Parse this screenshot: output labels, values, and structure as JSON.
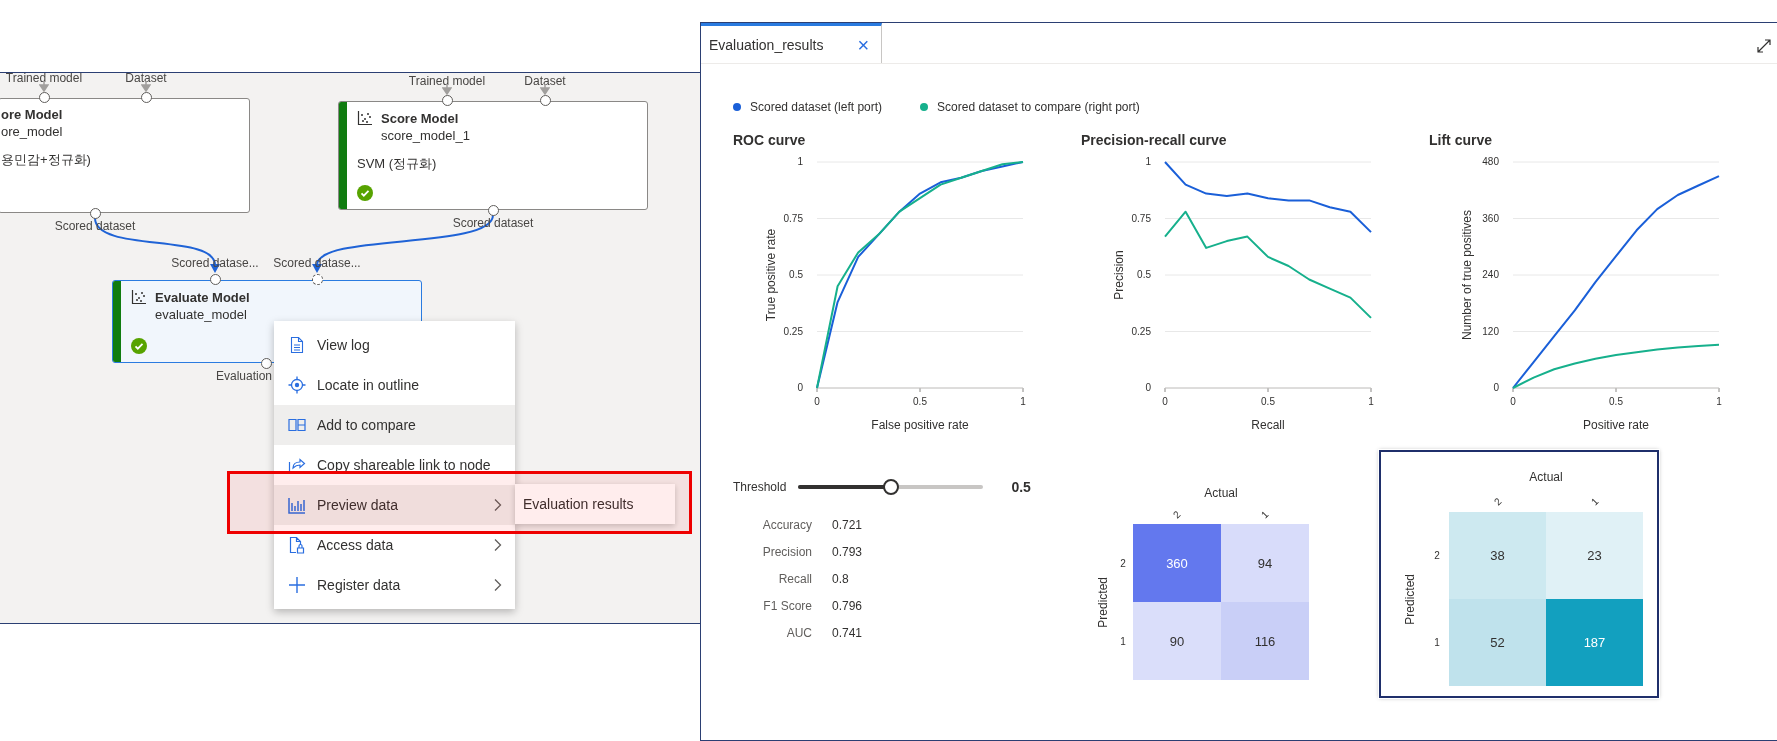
{
  "canvas": {
    "nodes": [
      {
        "title": "ore Model",
        "name": "ore_model",
        "description": "용민감+정규화)",
        "selected": false,
        "in_ports": [
          {
            "label": "Trained model",
            "connected": true
          },
          {
            "label": "Dataset",
            "connected": true
          }
        ],
        "out_ports": [
          {
            "label": "Scored dataset"
          }
        ]
      },
      {
        "title": "Score Model",
        "name": "score_model_1",
        "description": "SVM (정규화)",
        "completed": true,
        "selected": false,
        "in_ports": [
          {
            "label": "Trained model",
            "connected": true
          },
          {
            "label": "Dataset",
            "connected": true
          }
        ],
        "out_ports": [
          {
            "label": "Scored dataset"
          }
        ]
      },
      {
        "title": "Evaluate Model",
        "name": "evaluate_model",
        "completed": true,
        "selected": true,
        "in_ports": [
          {
            "label": "Scored datase...",
            "optional": false
          },
          {
            "label": "Scored datase...",
            "optional": true
          }
        ],
        "out_ports": [
          {
            "label": "Evaluation"
          }
        ]
      }
    ],
    "context_menu": {
      "items": [
        {
          "label": "View log",
          "highlighted": false,
          "submenu": false
        },
        {
          "label": "Locate in outline",
          "highlighted": false,
          "submenu": false
        },
        {
          "label": "Add to compare",
          "highlighted": true,
          "submenu": false
        },
        {
          "label": "Copy shareable link to node",
          "highlighted": false,
          "submenu": false
        },
        {
          "label": "Preview data",
          "highlighted": true,
          "submenu": true
        },
        {
          "label": "Access data",
          "highlighted": false,
          "submenu": true
        },
        {
          "label": "Register data",
          "highlighted": false,
          "submenu": true
        }
      ],
      "submenu": {
        "items": [
          "Evaluation results"
        ]
      },
      "highlight_box": true
    }
  },
  "panel": {
    "tabs": [
      {
        "label": "Evaluation_results",
        "selected": true,
        "close": "×"
      }
    ],
    "legend": [
      {
        "label": "Scored dataset (left port)",
        "color": "#1a5fd8"
      },
      {
        "label": "Scored dataset to compare (right port)",
        "color": "#16b08c"
      }
    ],
    "charts": [
      {
        "chart_data": {
          "type": "line",
          "title": "ROC curve",
          "xlabel": "False positive rate",
          "ylabel": "True positive rate",
          "x": [
            0,
            0.1,
            0.2,
            0.3,
            0.4,
            0.5,
            0.6,
            0.7,
            0.8,
            0.9,
            1
          ],
          "xlim": [
            0,
            1
          ],
          "ylim": [
            0,
            1
          ],
          "xticks": [
            0,
            0.5,
            1
          ],
          "yticks": [
            0,
            0.25,
            0.5,
            0.75,
            1
          ],
          "grid": true,
          "series": [
            {
              "color": "#1a5fd8",
              "values": [
                0,
                0.38,
                0.58,
                0.68,
                0.78,
                0.86,
                0.91,
                0.93,
                0.96,
                0.98,
                1
              ]
            },
            {
              "color": "#16b08c",
              "values": [
                0,
                0.45,
                0.6,
                0.68,
                0.78,
                0.84,
                0.9,
                0.93,
                0.96,
                0.99,
                1
              ]
            }
          ]
        }
      },
      {
        "chart_data": {
          "type": "line",
          "title": "Precision-recall curve",
          "xlabel": "Recall",
          "ylabel": "Precision",
          "x": [
            0,
            0.1,
            0.2,
            0.3,
            0.4,
            0.5,
            0.6,
            0.7,
            0.8,
            0.9,
            1
          ],
          "xlim": [
            0,
            1
          ],
          "ylim": [
            0,
            1
          ],
          "xticks": [
            0,
            0.5,
            1
          ],
          "yticks": [
            0,
            0.25,
            0.5,
            0.75,
            1
          ],
          "grid": true,
          "series": [
            {
              "color": "#1a5fd8",
              "values": [
                1,
                0.9,
                0.86,
                0.85,
                0.86,
                0.84,
                0.83,
                0.83,
                0.8,
                0.78,
                0.69
              ]
            },
            {
              "color": "#16b08c",
              "values": [
                0.67,
                0.78,
                0.62,
                0.65,
                0.67,
                0.58,
                0.54,
                0.48,
                0.44,
                0.4,
                0.31
              ]
            }
          ]
        }
      },
      {
        "chart_data": {
          "type": "line",
          "title": "Lift curve",
          "xlabel": "Positive rate",
          "ylabel": "Number of true positives",
          "x": [
            0,
            0.1,
            0.2,
            0.3,
            0.4,
            0.5,
            0.6,
            0.7,
            0.8,
            0.9,
            1
          ],
          "xlim": [
            0,
            1
          ],
          "ylim": [
            0,
            480
          ],
          "xticks": [
            0,
            0.5,
            1
          ],
          "yticks": [
            0,
            120,
            240,
            360,
            480
          ],
          "grid": true,
          "series": [
            {
              "color": "#1a5fd8",
              "values": [
                0,
                55,
                110,
                165,
                225,
                280,
                335,
                380,
                410,
                430,
                450
              ]
            },
            {
              "color": "#16b08c",
              "values": [
                0,
                22,
                40,
                52,
                62,
                70,
                76,
                82,
                86,
                89,
                92
              ]
            }
          ]
        }
      }
    ],
    "threshold": {
      "label": "Threshold",
      "level": 0.5,
      "value": "0.5"
    },
    "metrics": [
      {
        "label": "Accuracy",
        "value": "0.721"
      },
      {
        "label": "Precision",
        "value": "0.793"
      },
      {
        "label": "Recall",
        "value": "0.8"
      },
      {
        "label": "F1 Score",
        "value": "0.796"
      },
      {
        "label": "AUC",
        "value": "0.741"
      }
    ],
    "matrices": [
      {
        "column_title": "Actual",
        "row_title": "Predicted",
        "columns": [
          "2",
          "1"
        ],
        "selected": false,
        "rows": [
          {
            "label": "2",
            "cells": [
              {
                "value": "360",
                "color": "#6378ee"
              },
              {
                "value": "94",
                "color": "#d8dcfa"
              }
            ]
          },
          {
            "label": "1",
            "cells": [
              {
                "value": "90",
                "color": "#dadefa"
              },
              {
                "value": "116",
                "color": "#c9cff7"
              }
            ]
          }
        ]
      },
      {
        "column_title": "Actual",
        "row_title": "Predicted",
        "columns": [
          "2",
          "1"
        ],
        "selected": true,
        "rows": [
          {
            "label": "2",
            "cells": [
              {
                "value": "38",
                "color": "#cde9f0"
              },
              {
                "value": "23",
                "color": "#e0f1f6"
              }
            ]
          },
          {
            "label": "1",
            "cells": [
              {
                "value": "52",
                "color": "#bfe2ec"
              },
              {
                "value": "187",
                "color": "#12a0bf"
              }
            ]
          }
        ]
      }
    ]
  }
}
